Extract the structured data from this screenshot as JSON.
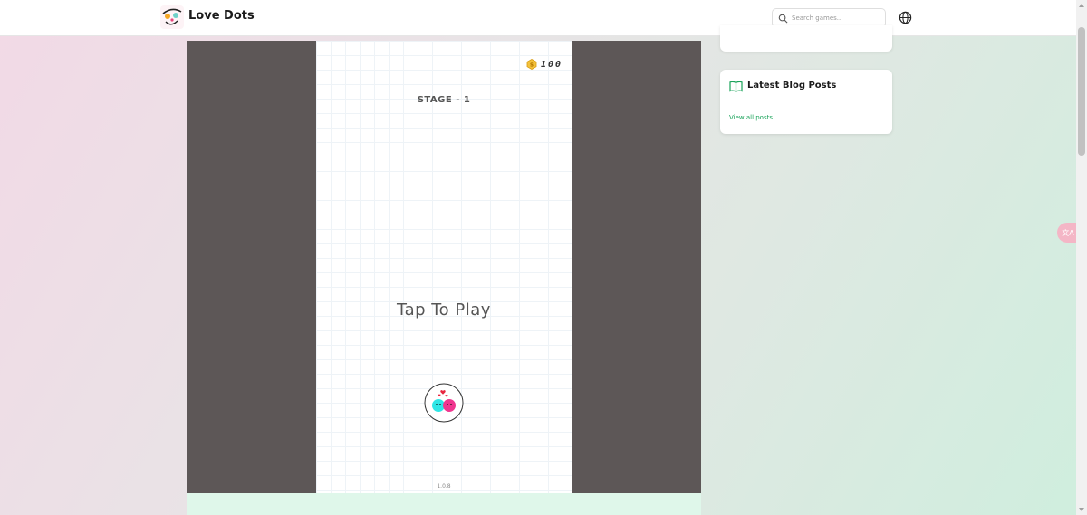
{
  "header": {
    "brand": "Love Dots",
    "search": {
      "placeholder": "Search games..."
    }
  },
  "game": {
    "coins": "100",
    "stage": "STAGE - 1",
    "prompt": "Tap To Play",
    "version": "1.0.8"
  },
  "sidebar": {
    "blog": {
      "title": "Latest Blog Posts",
      "link": "View all posts"
    }
  },
  "translate": {
    "label": "文A"
  },
  "colors": {
    "frame": "#5d5757",
    "accent_green": "#1aa35a",
    "dot_cyan": "#2ee6e6",
    "dot_pink": "#f0368f"
  },
  "icons": [
    "logo-icon",
    "search-icon",
    "globe-icon",
    "coin-icon",
    "love-dots-icon",
    "book-icon",
    "translate-icon"
  ]
}
